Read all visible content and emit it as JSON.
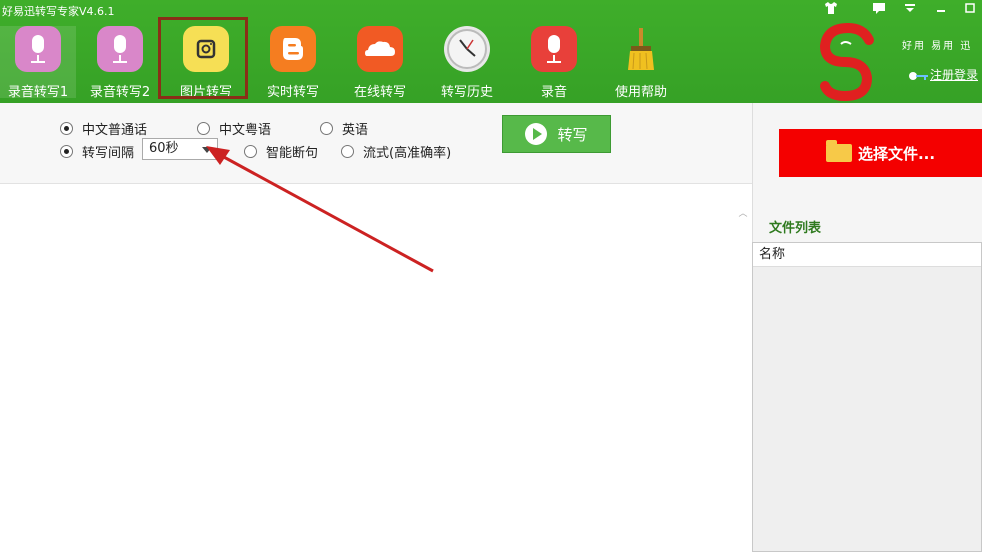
{
  "window": {
    "title": "好易迅转写专家V4.6.1"
  },
  "toolbar": {
    "items": [
      {
        "label": "录音转写1",
        "icon": "microphone-icon",
        "color": "#d987c9"
      },
      {
        "label": "录音转写2",
        "icon": "microphone-icon",
        "color": "#d987c9"
      },
      {
        "label": "图片转写",
        "icon": "camera-icon",
        "color": "#f6df55"
      },
      {
        "label": "实时转写",
        "icon": "blogger-icon",
        "color": "#f57d20"
      },
      {
        "label": "在线转写",
        "icon": "cloud-icon",
        "color": "#f15a24"
      },
      {
        "label": "转写历史",
        "icon": "clock-icon",
        "color": "#e8e8e8"
      },
      {
        "label": "录音",
        "icon": "microphone-icon",
        "color": "#e8403a"
      },
      {
        "label": "使用帮助",
        "icon": "broom-icon",
        "color": "#f0c020"
      }
    ]
  },
  "brand": {
    "slogan": "好用 易用 迅",
    "login": "注册登录"
  },
  "options": {
    "lang_mandarin": "中文普通话",
    "lang_cantonese": "中文粤语",
    "lang_english": "英语",
    "interval_label": "转写间隔",
    "interval_value": "60秒",
    "smart_sentence": "智能断句",
    "streaming": "流式(高准确率)"
  },
  "transcribe_button": "转写",
  "right_panel": {
    "select_file": "选择文件...",
    "file_list_title": "文件列表",
    "column_name": "名称"
  }
}
